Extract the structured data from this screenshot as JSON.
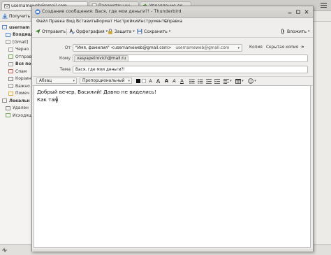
{
  "browser_tabs": [
    {
      "label": "usernameweb@gmail.com",
      "active": true
    },
    {
      "label": "Параметры учётной зап",
      "active": false
    },
    {
      "label": "Управление дополнени",
      "active": false
    }
  ],
  "main_toolbar": {
    "get_mail_label": "Получить"
  },
  "folders": [
    {
      "label": "usernam",
      "bold": true,
      "icon": "account-icon"
    },
    {
      "label": "Входящ",
      "bold": true,
      "icon": "inbox-icon"
    },
    {
      "label": "[Gmail]",
      "bold": false,
      "icon": "folder-icon"
    },
    {
      "label": "Черно",
      "bold": false,
      "icon": "folder-icon"
    },
    {
      "label": "Отправ",
      "bold": false,
      "icon": "sent-icon"
    },
    {
      "label": "Вся по",
      "bold": true,
      "icon": "folder-icon"
    },
    {
      "label": "Спам",
      "bold": false,
      "icon": "spam-icon"
    },
    {
      "label": "Корзин",
      "bold": false,
      "icon": "trash-icon"
    },
    {
      "label": "Важно",
      "bold": false,
      "icon": "folder-icon"
    },
    {
      "label": "Помеч",
      "bold": false,
      "icon": "star-icon"
    },
    {
      "label": "Локальн",
      "bold": true,
      "icon": "local-icon"
    },
    {
      "label": "Удален",
      "bold": false,
      "icon": "trash-icon"
    },
    {
      "label": "Исходящ",
      "bold": false,
      "icon": "outbox-icon"
    }
  ],
  "compose": {
    "window_title": "Создание сообщения: Вася, где мои деньги?! - Thunderbird",
    "menu": [
      "Файл",
      "Правка",
      "Вид",
      "Вставить",
      "Формат",
      "Настройки",
      "Инструменты",
      "Справка"
    ],
    "toolbar": {
      "send": "Отправить",
      "spelling": "Орфография",
      "security": "Защита",
      "save": "Сохранить",
      "attach": "Вложить"
    },
    "headers": {
      "from_label": "От",
      "from_value": "\"Имя, фамилия\" <usernameweb@gmail.com>",
      "from_account": "usernameweb@gmail.com",
      "cc_link": "Копия",
      "bcc_link": "Скрытая копия",
      "to_label": "Кому",
      "to_value": "vasyapetrovich@mail.ru",
      "subject_label": "Тема",
      "subject_value": "Вася, где мои деньги?!"
    },
    "format": {
      "paragraph": "Абзац",
      "font": "Пропорциональный"
    },
    "body_lines": [
      "Добрый вечер, Василий! Давно не виделись!",
      "Как там"
    ]
  },
  "colors": {
    "accent_blue": "#2a6fc9",
    "send_green": "#3a7a2a"
  }
}
